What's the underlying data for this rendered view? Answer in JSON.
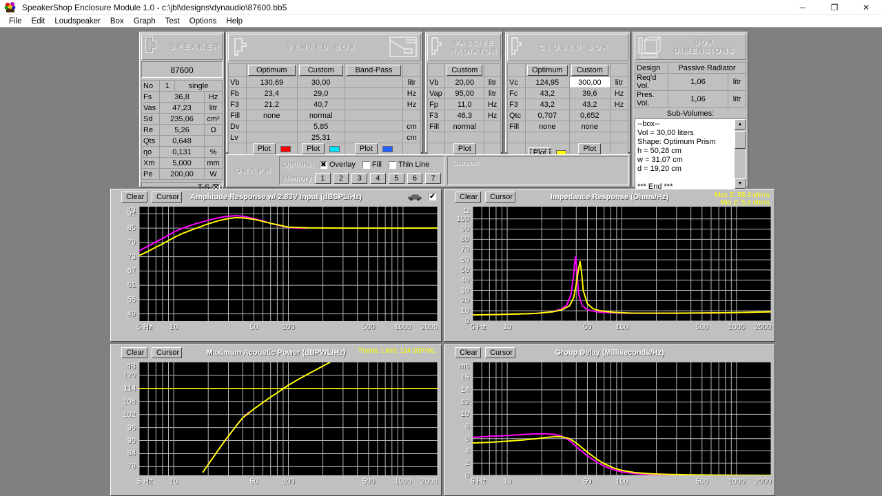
{
  "window": {
    "title": "SpeakerShop Enclosure Module 1.0 - c:\\jbl\\designs\\dynaudio\\87600.bb5",
    "app_icon": "speaker-app-icon",
    "minimize": "─",
    "maximize": "❐",
    "close": "✕"
  },
  "menu": {
    "items": [
      "File",
      "Edit",
      "Loudspeaker",
      "Box",
      "Graph",
      "Test",
      "Options",
      "Help"
    ]
  },
  "speaker": {
    "header": "SPEAKER",
    "name": "87600",
    "ts_label": "T-S",
    "ts_checked": "☒",
    "no_label": "No",
    "no_value": "1",
    "no_mode": "single",
    "rows": [
      {
        "label": "Fs",
        "value": "36,8",
        "unit": "Hz"
      },
      {
        "label": "Vas",
        "value": "47,23",
        "unit": "litr"
      },
      {
        "label": "Sd",
        "value": "235,06",
        "unit": "cm²"
      },
      {
        "label": "Re",
        "value": "5,26",
        "unit": "Ω"
      },
      {
        "label": "Qts",
        "value": "0,648",
        "unit": ""
      },
      {
        "label": "ηo",
        "value": "0,131",
        "unit": "%"
      },
      {
        "label": "Xm",
        "value": "5,000",
        "unit": "mm"
      },
      {
        "label": "Pe",
        "value": "200,00",
        "unit": "W"
      }
    ]
  },
  "vented": {
    "header": "VENTED BOX",
    "columns": [
      "Optimum",
      "Custom",
      "Band-Pass"
    ],
    "rows": [
      {
        "label": "Vb",
        "optimum": "130,69",
        "custom": "30,00",
        "bandpass": "",
        "unit": "litr"
      },
      {
        "label": "Fb",
        "optimum": "23,4",
        "custom": "29,0",
        "bandpass": "",
        "unit": "Hz"
      },
      {
        "label": "F3",
        "optimum": "21,2",
        "custom": "40,7",
        "bandpass": "",
        "unit": "Hz"
      },
      {
        "label": "Fill",
        "optimum": "none",
        "custom": "normal",
        "bandpass": "",
        "unit": ""
      },
      {
        "label": "Dv",
        "optimum": "",
        "custom": "5,85",
        "bandpass": "",
        "unit": "cm"
      },
      {
        "label": "Lv",
        "optimum": "",
        "custom": "25,31",
        "bandpass": "",
        "unit": "cm"
      }
    ],
    "plot_label": "Plot",
    "plot_colors": [
      "#ff0000",
      "#00e5ff",
      "#2060ff"
    ]
  },
  "passive": {
    "header": "PASSIVE\nRADIATOR",
    "columns": [
      "Custom"
    ],
    "rows": [
      {
        "label": "Vb",
        "value": "20,00",
        "unit": "litr"
      },
      {
        "label": "Vap",
        "value": "95,00",
        "unit": "litr"
      },
      {
        "label": "Fp",
        "value": "11,0",
        "unit": "Hz"
      },
      {
        "label": "F3",
        "value": "46,3",
        "unit": "Hz"
      },
      {
        "label": "Fill",
        "value": "normal",
        "unit": ""
      }
    ],
    "plot_label": "Plot",
    "plot_color": "#00e000"
  },
  "closed": {
    "header": "CLOSED BOX",
    "columns": [
      "Optimum",
      "Custom"
    ],
    "rows": [
      {
        "label": "Vc",
        "optimum": "124,95",
        "custom": "300,00",
        "unit": "litr"
      },
      {
        "label": "Fc",
        "optimum": "43,2",
        "custom": "39,6",
        "unit": "Hz"
      },
      {
        "label": "F3",
        "optimum": "43,2",
        "custom": "43,2",
        "unit": "Hz"
      },
      {
        "label": "Qtc",
        "optimum": "0,707",
        "custom": "0,652",
        "unit": ""
      },
      {
        "label": "Fill",
        "optimum": "none",
        "custom": "none",
        "unit": ""
      }
    ],
    "plot_label": "Plot",
    "plot_colors": [
      "#ffff00",
      "#ff00ff"
    ]
  },
  "boxdim": {
    "header": "BOX\nDIMENSIONS",
    "design_label": "Design",
    "design_value": "Passive Radiator",
    "rows": [
      {
        "label": "Req'd Vol.",
        "value": "1,06",
        "unit": "litr"
      },
      {
        "label": "Pres. Vol.",
        "value": "1,06",
        "unit": "litr"
      }
    ],
    "subvol_label": "Sub-Volumes:",
    "subvol_lines": [
      "--box--",
      "Vol = 30,00 liters",
      "Shape: Optimum Prism",
      "h = 50,28 cm",
      "w = 31,07 cm",
      "d = 19,20 cm",
      "",
      "*** End ***"
    ],
    "scroll_up": "▲",
    "scroll_down": "▼"
  },
  "graphbar": {
    "header": "GRAPH",
    "options_label": "Options:",
    "overlay_label": "Overlay",
    "overlay_checked": true,
    "fill_label": "Fill",
    "fill_checked": false,
    "thinline_label": "Thin Line",
    "thinline_checked": false,
    "memory_label": "Memory:",
    "memory_buttons": [
      "1",
      "2",
      "3",
      "4",
      "5",
      "6",
      "7"
    ],
    "cursor_label": "Cursor:",
    "cursor_value": ""
  },
  "graph_buttons": {
    "clear": "Clear",
    "cursor": "Cursor"
  },
  "chart_data": [
    {
      "id": "amplitude",
      "type": "line",
      "title": "Amplitude Response w/ 2.83V Input (dBSPL/Hz)",
      "xlabel": "",
      "ylabel": "dB",
      "xlog": true,
      "xlim": [
        5,
        2000
      ],
      "xticks": [
        5,
        10,
        50,
        100,
        500,
        1000,
        2000
      ],
      "xticklabels": [
        "5 Hz",
        "10",
        "50",
        "100",
        "500",
        "1000",
        "2000"
      ],
      "ylim": [
        46,
        94
      ],
      "yticks": [
        49,
        55,
        61,
        67,
        73,
        79,
        85,
        91
      ],
      "yticklabels": [
        "49",
        "55",
        "61",
        "67",
        "73",
        "79",
        "85",
        "91"
      ],
      "grid": true,
      "legend": "none",
      "has_car_toggle": true,
      "series": [
        {
          "name": "closed-box-custom",
          "color": "#ff00ff",
          "x": [
            5,
            6,
            7,
            8,
            10,
            12,
            15,
            20,
            25,
            30,
            35,
            40,
            50,
            60,
            70,
            80,
            100,
            120,
            150
          ],
          "values": [
            75.5,
            77.5,
            79.2,
            80.7,
            83.3,
            85.0,
            86.6,
            88.3,
            89.4,
            90.0,
            90.2,
            90.0,
            89.0,
            88.0,
            87.0,
            86.3,
            85.3,
            85.0,
            85.0
          ]
        },
        {
          "name": "closed-box-optimum",
          "color": "#ffff00",
          "x": [
            5,
            6,
            7,
            8,
            10,
            12,
            15,
            20,
            25,
            30,
            35,
            40,
            50,
            60,
            70,
            80,
            100,
            150,
            300,
            600,
            1200,
            2000
          ],
          "values": [
            73.5,
            75.3,
            77.0,
            78.4,
            81.0,
            82.8,
            84.6,
            86.8,
            88.2,
            89.0,
            89.4,
            89.3,
            88.7,
            87.8,
            87.0,
            86.4,
            85.4,
            85.1,
            85.0,
            85.0,
            85.0,
            85.0
          ]
        }
      ]
    },
    {
      "id": "impedance",
      "type": "line",
      "title": "Impedance Response (Ohms/Hz)",
      "annotations": [
        "Max Z: 58,3 ohms",
        "Min Z: 5,9 ohms"
      ],
      "annotation_color": "#ffff00",
      "xlabel": "",
      "ylabel": "Ω",
      "xlog": true,
      "xlim": [
        5,
        2000
      ],
      "xticks": [
        5,
        10,
        50,
        100,
        500,
        1000,
        2000
      ],
      "xticklabels": [
        "5 Hz",
        "10",
        "50",
        "100",
        "500",
        "1000",
        "2000"
      ],
      "ylim": [
        0,
        112
      ],
      "yticks": [
        0,
        10,
        20,
        30,
        40,
        50,
        60,
        70,
        80,
        90,
        100
      ],
      "yticklabels": [
        "0",
        "10",
        "20",
        "30",
        "40",
        "50",
        "60",
        "70",
        "80",
        "90",
        "100"
      ],
      "grid": true,
      "series": [
        {
          "name": "impedance-magenta",
          "color": "#ff00ff",
          "x": [
            5,
            8,
            12,
            18,
            25,
            30,
            33,
            36,
            38,
            39,
            39.6,
            40.5,
            42,
            45,
            50,
            60,
            80,
            120,
            300,
            800,
            2000
          ],
          "values": [
            6.0,
            6.3,
            6.8,
            7.5,
            9.2,
            12.0,
            15.5,
            26.0,
            46.0,
            60.0,
            63.0,
            48.0,
            26.0,
            15.0,
            11.0,
            9.0,
            8.0,
            7.6,
            7.6,
            8.0,
            9.0
          ]
        },
        {
          "name": "impedance-yellow",
          "color": "#ffff00",
          "x": [
            5,
            8,
            12,
            18,
            25,
            30,
            35,
            38,
            40,
            42,
            43.2,
            44.5,
            46,
            50,
            56,
            65,
            85,
            120,
            300,
            800,
            2000
          ],
          "values": [
            6.0,
            6.3,
            6.8,
            7.5,
            9.0,
            11.0,
            15.0,
            23.0,
            36.0,
            52.0,
            58.3,
            48.0,
            30.0,
            17.0,
            12.0,
            10.0,
            8.5,
            7.8,
            7.7,
            8.1,
            9.0
          ]
        }
      ]
    },
    {
      "id": "maxpower",
      "type": "line",
      "title": "Maximum Acoustic Power (dBPWL/Hz)",
      "annotations": [
        "Therm. Limit: 114 dBPWL"
      ],
      "annotation_color": "#ffff00",
      "xlabel": "",
      "ylabel": "dB",
      "xlog": true,
      "xlim": [
        5,
        2000
      ],
      "xticks": [
        5,
        10,
        50,
        100,
        500,
        1000,
        2000
      ],
      "xticklabels": [
        "5 Hz",
        "10",
        "50",
        "100",
        "500",
        "1000",
        "2000"
      ],
      "ylim": [
        74,
        126
      ],
      "yticks": [
        78,
        84,
        90,
        96,
        102,
        108,
        114,
        120
      ],
      "yticklabels": [
        "78",
        "84",
        "90",
        "96",
        "102",
        "108",
        "114",
        "120"
      ],
      "highlight_y": 114,
      "highlight_color": "#ffff00",
      "grid": true,
      "series": [
        {
          "name": "max-power-magenta",
          "color": "#ff00ff",
          "x": [
            18,
            20,
            24,
            28,
            32,
            36,
            40,
            45
          ],
          "values": [
            75.5,
            79.0,
            85.0,
            90.0,
            94.0,
            97.5,
            100.5,
            103.0
          ]
        },
        {
          "name": "max-power-yellow",
          "color": "#ffff00",
          "x": [
            18,
            20,
            24,
            28,
            32,
            36,
            40,
            50,
            60,
            70,
            80,
            100,
            130,
            180,
            230
          ],
          "values": [
            75.5,
            79.0,
            85.0,
            90.0,
            94.0,
            97.5,
            100.5,
            104.5,
            107.5,
            110.0,
            112.0,
            115.5,
            119.0,
            123.0,
            126.0
          ]
        }
      ]
    },
    {
      "id": "groupdelay",
      "type": "line",
      "title": "Group Delay (Milliseconds/Hz)",
      "xlabel": "",
      "ylabel": "ms",
      "xlog": true,
      "xlim": [
        5,
        2000
      ],
      "xticks": [
        5,
        10,
        50,
        100,
        500,
        1000,
        2000
      ],
      "xticklabels": [
        "5 Hz",
        "10",
        "50",
        "100",
        "500",
        "1000",
        "2000"
      ],
      "ylim": [
        0,
        18.5
      ],
      "yticks": [
        0,
        2,
        4,
        6,
        8,
        10,
        12,
        14,
        16
      ],
      "yticklabels": [
        "0",
        "2",
        "4",
        "6",
        "8",
        "10",
        "12",
        "14",
        "16"
      ],
      "grid": true,
      "series": [
        {
          "name": "group-delay-magenta",
          "color": "#ff00ff",
          "x": [
            5,
            7,
            10,
            14,
            18,
            22,
            26,
            30,
            35,
            40,
            45,
            50,
            60,
            70,
            85,
            100,
            130,
            180,
            250,
            400,
            900,
            2000
          ],
          "values": [
            6.2,
            6.4,
            6.5,
            6.7,
            6.8,
            6.8,
            6.7,
            6.4,
            5.7,
            4.7,
            3.9,
            3.2,
            2.2,
            1.5,
            0.9,
            0.55,
            0.3,
            0.15,
            0.1,
            0.05,
            0.02,
            0.0
          ]
        },
        {
          "name": "group-delay-yellow",
          "color": "#ffff00",
          "x": [
            5,
            7,
            10,
            14,
            18,
            22,
            26,
            30,
            35,
            40,
            45,
            50,
            60,
            70,
            85,
            100,
            130,
            180,
            250,
            400,
            900,
            2000
          ],
          "values": [
            5.3,
            5.4,
            5.6,
            5.8,
            6.0,
            6.2,
            6.35,
            6.3,
            6.0,
            5.3,
            4.5,
            3.8,
            2.7,
            1.9,
            1.2,
            0.8,
            0.45,
            0.25,
            0.15,
            0.08,
            0.03,
            0.0
          ]
        }
      ]
    }
  ]
}
